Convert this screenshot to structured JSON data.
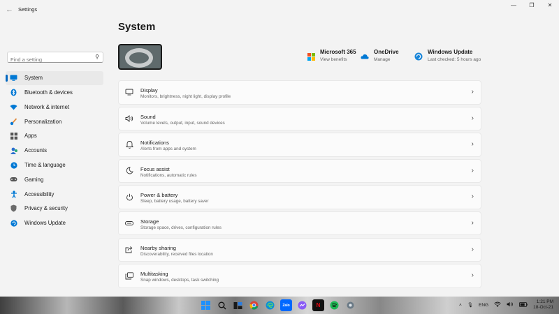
{
  "window": {
    "title": "Settings",
    "back_icon": "back-arrow-icon"
  },
  "search": {
    "placeholder": "Find a setting"
  },
  "sidebar": {
    "items": [
      {
        "label": "System",
        "icon": "monitor-icon",
        "color": "#0078d4",
        "active": true
      },
      {
        "label": "Bluetooth & devices",
        "icon": "bluetooth-icon",
        "color": "#0078d4"
      },
      {
        "label": "Network & internet",
        "icon": "wifi-icon",
        "color": "#0078d4"
      },
      {
        "label": "Personalization",
        "icon": "brush-icon",
        "color": "#e08a3c"
      },
      {
        "label": "Apps",
        "icon": "apps-icon",
        "color": "#555555"
      },
      {
        "label": "Accounts",
        "icon": "person-icon",
        "color": "#2aa876"
      },
      {
        "label": "Time & language",
        "icon": "globe-clock-icon",
        "color": "#0078d4"
      },
      {
        "label": "Gaming",
        "icon": "gamepad-icon",
        "color": "#555555"
      },
      {
        "label": "Accessibility",
        "icon": "accessibility-icon",
        "color": "#0078d4"
      },
      {
        "label": "Privacy & security",
        "icon": "shield-icon",
        "color": "#6b6b6b"
      },
      {
        "label": "Windows Update",
        "icon": "update-icon",
        "color": "#0078d4"
      }
    ]
  },
  "main": {
    "title": "System",
    "quick_links": [
      {
        "title": "Microsoft 365",
        "subtitle": "View benefits",
        "icon": "microsoft-logo-icon"
      },
      {
        "title": "OneDrive",
        "subtitle": "Manage",
        "icon": "cloud-icon"
      },
      {
        "title": "Windows Update",
        "subtitle": "Last checked: 5 hours ago",
        "icon": "update-icon"
      }
    ],
    "cards": [
      {
        "title": "Display",
        "subtitle": "Monitors, brightness, night light, display profile",
        "icon": "display-icon"
      },
      {
        "title": "Sound",
        "subtitle": "Volume levels, output, input, sound devices",
        "icon": "speaker-icon"
      },
      {
        "title": "Notifications",
        "subtitle": "Alerts from apps and system",
        "icon": "bell-icon"
      },
      {
        "title": "Focus assist",
        "subtitle": "Notifications, automatic rules",
        "icon": "moon-icon"
      },
      {
        "title": "Power & battery",
        "subtitle": "Sleep, battery usage, battery saver",
        "icon": "power-icon"
      },
      {
        "title": "Storage",
        "subtitle": "Storage space, drives, configuration rules",
        "icon": "drive-icon"
      },
      {
        "title": "Nearby sharing",
        "subtitle": "Discoverability, received files location",
        "icon": "share-icon"
      },
      {
        "title": "Multitasking",
        "subtitle": "Snap windows, desktops, task switching",
        "icon": "multitask-icon"
      }
    ]
  },
  "taskbar": {
    "apps": [
      "windows-start-icon",
      "search-icon",
      "task-view-icon",
      "chrome-icon",
      "edge-icon",
      "zalo-icon",
      "messenger-icon",
      "netflix-icon",
      "spotify-icon",
      "settings-icon"
    ],
    "tray": {
      "language": "ENG",
      "time": "1:21 PM",
      "date": "18-Oct-21"
    }
  }
}
